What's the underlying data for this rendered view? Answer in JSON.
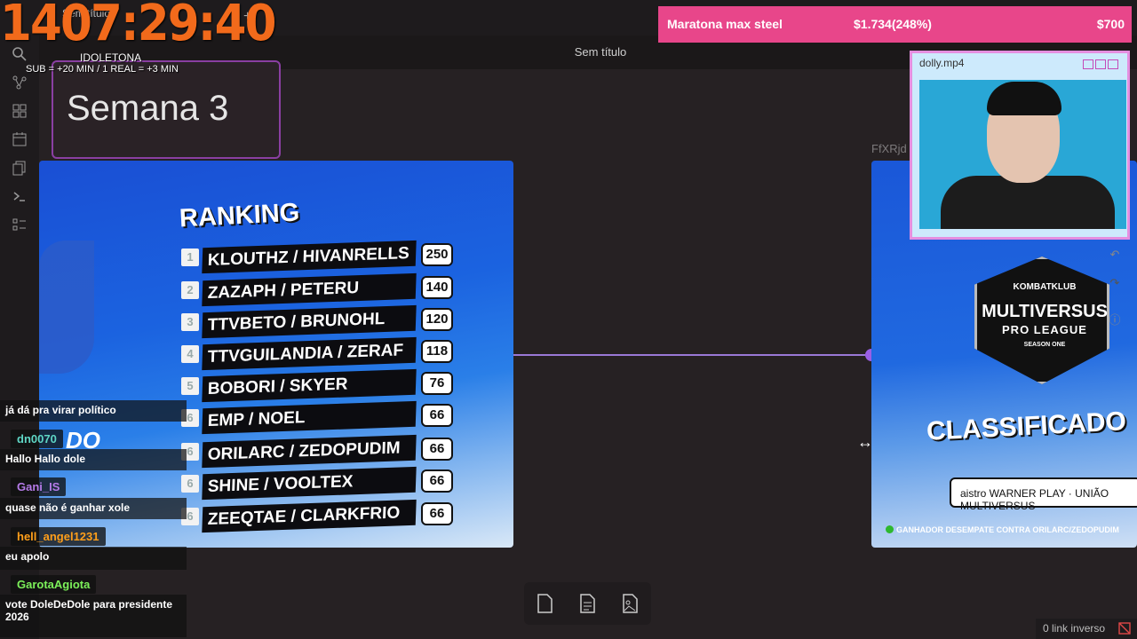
{
  "app": {
    "tab_title": "Sem título",
    "page_title": "Sem título",
    "new_tab_glyph": "+"
  },
  "overlay": {
    "timer": "1407:29:40",
    "channel_name": "IDOLETONA",
    "subathon_rules": "SUB = +20  MIN / 1 REAL = +3 MIN",
    "goal_title": "Maratona max steel",
    "goal_progress": "$1.734(248%)",
    "goal_target": "$700"
  },
  "canvas": {
    "week_title": "Semana 3",
    "ranking": {
      "title": "RANKING",
      "partial_text": "DO",
      "rows": [
        {
          "pos": "1",
          "team": "KLOUTHZ / HIVANRELLS",
          "points": "250"
        },
        {
          "pos": "2",
          "team": "ZAZAPH / PETERU",
          "points": "140"
        },
        {
          "pos": "3",
          "team": "TTVBETO / BRUNOHL",
          "points": "120"
        },
        {
          "pos": "4",
          "team": "TTVGUILANDIA / ZERAF",
          "points": "118"
        },
        {
          "pos": "5",
          "team": "BOBORI / SKYER",
          "points": "76"
        },
        {
          "pos": "6",
          "team": "EMP / NOEL",
          "points": "66"
        },
        {
          "pos": "6",
          "team": "ORILARC / ZEDOPUDIM",
          "points": "66"
        },
        {
          "pos": "6",
          "team": "SHINE / VOOLTEX",
          "points": "66"
        },
        {
          "pos": "6",
          "team": "ZEEQTAE / CLARKFRIO",
          "points": "66"
        }
      ]
    },
    "classif_node_label": "FfXRjd",
    "classif": {
      "badge_top": "KOMBATKLUB",
      "badge_main": "MULTIVERSUS",
      "badge_sub": "PRO LEAGUE",
      "badge_season": "SEASON ONE",
      "title": "CLASSIFICADO",
      "sponsors": "aistro  WARNER PLAY  ·  UNIÃO MULTIVERSUS",
      "footer": "GANHADOR DESEMPATE CONTRA ORILARC/ZEDOPUDIM"
    }
  },
  "webcam": {
    "title": "dolly.mp4"
  },
  "chat": [
    {
      "type": "msg",
      "text": "já dá pra virar político"
    },
    {
      "type": "user",
      "name": "dn0070",
      "color": "#5fd6c5"
    },
    {
      "type": "msg",
      "text": "Hallo Hallo dole"
    },
    {
      "type": "user",
      "name": "Gani_IS",
      "color": "#b57be8"
    },
    {
      "type": "msg",
      "text": "quase não é ganhar xole"
    },
    {
      "type": "user",
      "name": "hell_angel1231",
      "color": "#ff9f1a"
    },
    {
      "type": "msg",
      "text": "eu apolo"
    },
    {
      "type": "user",
      "name": "GarotaAgiota",
      "color": "#7cf05a"
    },
    {
      "type": "msg",
      "text": "vote DoleDeDole para presidente 2026"
    }
  ],
  "status": {
    "backlinks": "0 link inverso"
  },
  "colors": {
    "accent_purple": "#9a5fe6",
    "timer_orange": "#f26a1b",
    "goal_pink": "#e8468a"
  }
}
